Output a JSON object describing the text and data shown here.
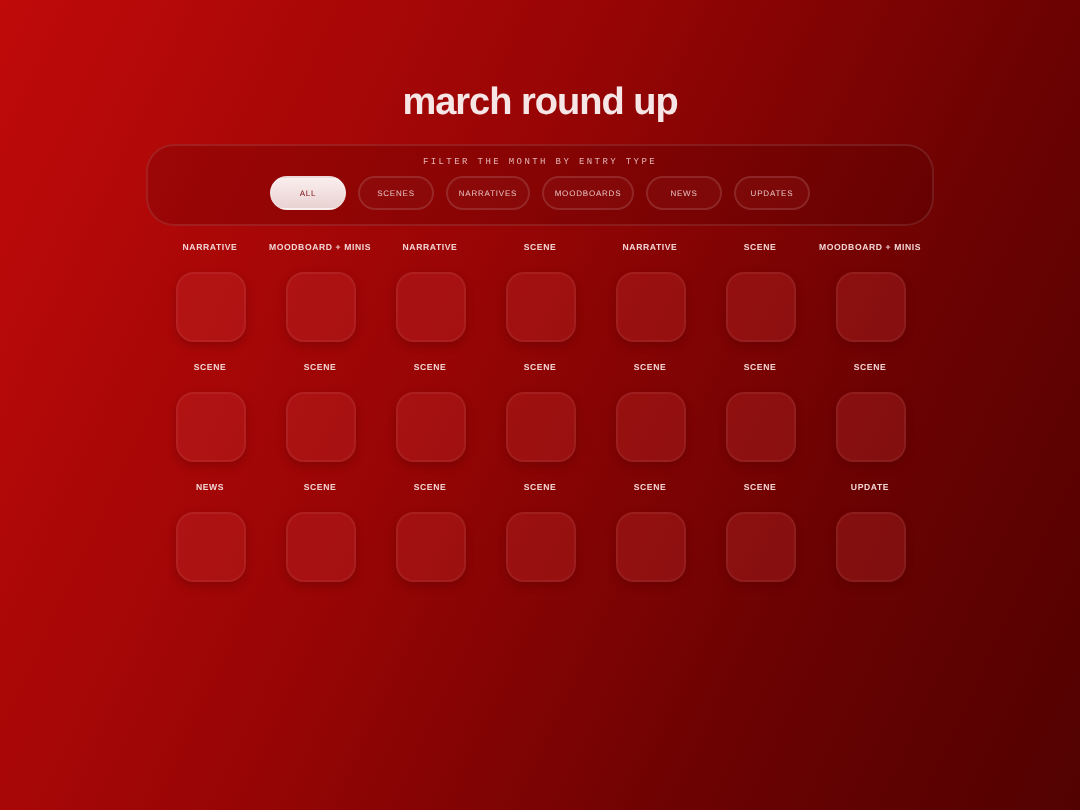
{
  "title": "march round up",
  "filter": {
    "label": "FILTER THE MONTH BY ENTRY TYPE",
    "options": [
      {
        "label": "ALL",
        "selected": true
      },
      {
        "label": "SCENES",
        "selected": false
      },
      {
        "label": "NARRATIVES",
        "selected": false
      },
      {
        "label": "MOODBOARDS",
        "selected": false
      },
      {
        "label": "NEWS",
        "selected": false
      },
      {
        "label": "UPDATES",
        "selected": false
      }
    ]
  },
  "entries": [
    {
      "label": "NARRATIVE"
    },
    {
      "label": "MOODBOARD + MINIS"
    },
    {
      "label": "NARRATIVE"
    },
    {
      "label": "SCENE"
    },
    {
      "label": "NARRATIVE"
    },
    {
      "label": "SCENE"
    },
    {
      "label": "MOODBOARD + MINIS"
    },
    {
      "label": "SCENE"
    },
    {
      "label": "SCENE"
    },
    {
      "label": "SCENE"
    },
    {
      "label": "SCENE"
    },
    {
      "label": "SCENE"
    },
    {
      "label": "SCENE"
    },
    {
      "label": "SCENE"
    },
    {
      "label": "NEWS"
    },
    {
      "label": "SCENE"
    },
    {
      "label": "SCENE"
    },
    {
      "label": "SCENE"
    },
    {
      "label": "SCENE"
    },
    {
      "label": "SCENE"
    },
    {
      "label": "UPDATE"
    }
  ]
}
